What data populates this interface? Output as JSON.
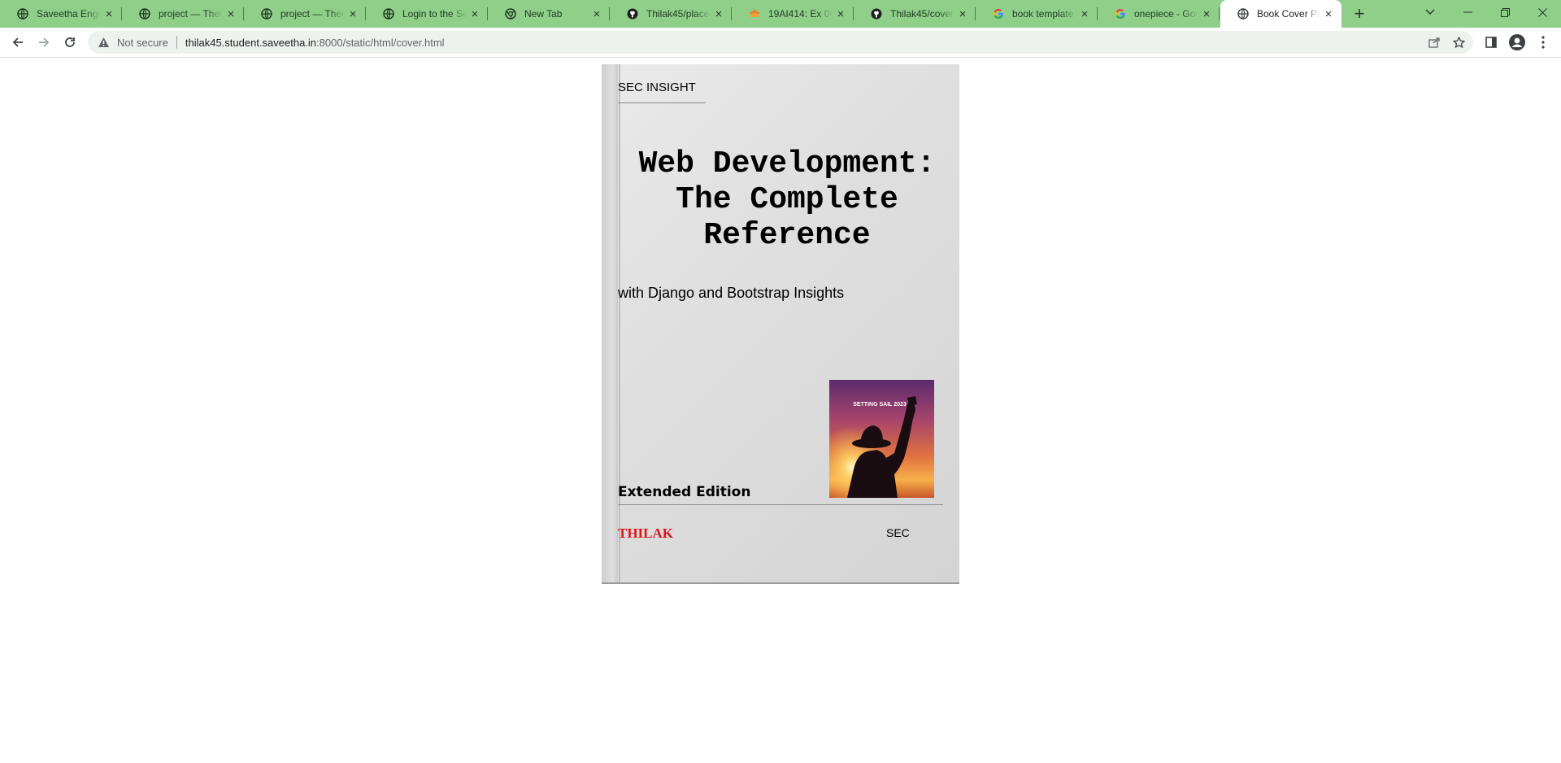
{
  "browser": {
    "tabs": [
      {
        "title": "Saveetha Engine",
        "icon": "globe-icon"
      },
      {
        "title": "project — Theia",
        "icon": "globe-icon"
      },
      {
        "title": "project — Theia",
        "icon": "globe-icon"
      },
      {
        "title": "Login to the Ser",
        "icon": "globe-icon"
      },
      {
        "title": "New Tab",
        "icon": "chrome-icon"
      },
      {
        "title": "Thilak45/places",
        "icon": "github-icon"
      },
      {
        "title": "19AI414: Ex 06:",
        "icon": "moodle-icon"
      },
      {
        "title": "Thilak45/cover-",
        "icon": "github-icon"
      },
      {
        "title": "book template",
        "icon": "google-icon"
      },
      {
        "title": "onepiece - Goo",
        "icon": "google-icon"
      },
      {
        "title": "Book Cover Pag",
        "icon": "globe-icon"
      }
    ],
    "active_tab": 10,
    "address_bar": {
      "security_label": "Not secure",
      "url_host": "thilak45.student.saveetha.in",
      "url_path": ":8000/static/html/cover.html"
    },
    "colors": {
      "frame": "#8fcf8a",
      "active_tab": "#ffffff"
    }
  },
  "cover": {
    "publisher": "SEC INSIGHT",
    "title_lines": [
      "Web Development:",
      "The Complete",
      "Reference"
    ],
    "subtitle": "with Django and Bootstrap Insights",
    "image_caption": "SETTING SAIL 2023",
    "edition": "Extended Edition",
    "author": "THILAK",
    "imprint": "SEC",
    "colors": {
      "author": "#e0151b"
    }
  }
}
